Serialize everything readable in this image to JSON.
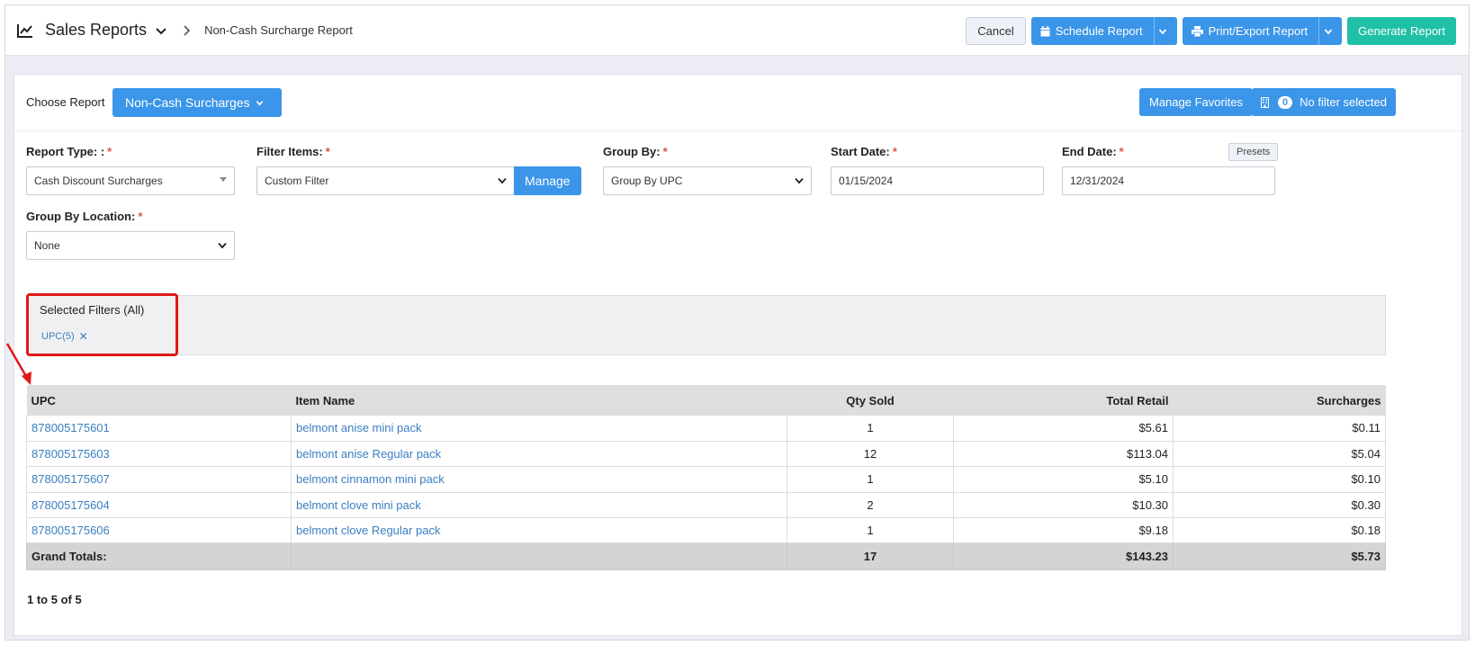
{
  "header": {
    "title": "Sales Reports",
    "breadcrumb": "Non-Cash Surcharge Report",
    "buttons": {
      "cancel": "Cancel",
      "schedule": "Schedule Report",
      "print_export": "Print/Export Report",
      "generate": "Generate Report"
    }
  },
  "choose_report": {
    "label": "Choose Report",
    "selected": "Non-Cash Surcharges",
    "manage_favorites": "Manage Favorites",
    "filter_count": "0",
    "filter_status": "No filter selected"
  },
  "form": {
    "report_type": {
      "label": "Report Type: :",
      "value": "Cash Discount Surcharges"
    },
    "filter_items": {
      "label": "Filter Items:",
      "value": "Custom Filter",
      "manage": "Manage"
    },
    "group_by": {
      "label": "Group By:",
      "value": "Group By UPC"
    },
    "start_date": {
      "label": "Start Date:",
      "value": "01/15/2024"
    },
    "end_date": {
      "label": "End Date:",
      "value": "12/31/2024"
    },
    "presets": "Presets",
    "group_by_location": {
      "label": "Group By Location:",
      "value": "None"
    },
    "required_mark": "*"
  },
  "selected_filters": {
    "title": "Selected Filters (All)",
    "chip": "UPC(5)"
  },
  "table": {
    "columns": [
      "UPC",
      "Item Name",
      "Qty Sold",
      "Total Retail",
      "Surcharges"
    ],
    "rows": [
      [
        "878005175601",
        "belmont anise mini pack",
        "1",
        "$5.61",
        "$0.11"
      ],
      [
        "878005175603",
        "belmont anise Regular pack",
        "12",
        "$113.04",
        "$5.04"
      ],
      [
        "878005175607",
        "belmont cinnamon mini pack",
        "1",
        "$5.10",
        "$0.10"
      ],
      [
        "878005175604",
        "belmont clove mini pack",
        "2",
        "$10.30",
        "$0.30"
      ],
      [
        "878005175606",
        "belmont clove Regular pack",
        "1",
        "$9.18",
        "$0.18"
      ]
    ],
    "totals": {
      "label": "Grand Totals:",
      "qty": "17",
      "retail": "$143.23",
      "surcharges": "$5.73"
    }
  },
  "pager": "1 to 5 of 5",
  "colors": {
    "accent_blue": "#3b95e8",
    "teal": "#1fc0a6",
    "link": "#3a7fc1",
    "annotation_red": "#e01919"
  }
}
